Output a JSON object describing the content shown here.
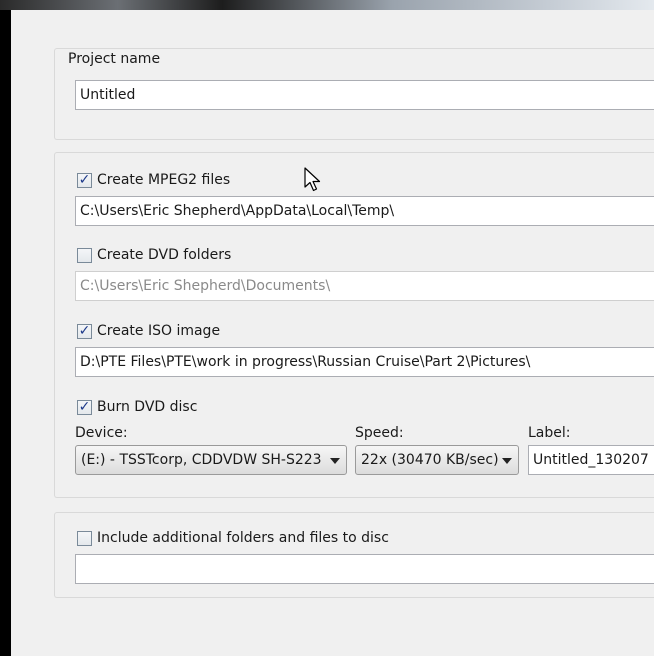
{
  "project": {
    "label": "Project name",
    "value": "Untitled"
  },
  "mpeg2": {
    "label": "Create MPEG2 files",
    "checked": true,
    "path": "C:\\Users\\Eric Shepherd\\AppData\\Local\\Temp\\"
  },
  "dvd_folders": {
    "label": "Create DVD folders",
    "checked": false,
    "path": "C:\\Users\\Eric Shepherd\\Documents\\"
  },
  "iso": {
    "label": "Create ISO image",
    "checked": true,
    "path": "D:\\PTE Files\\PTE\\work in progress\\Russian Cruise\\Part 2\\Pictures\\"
  },
  "burn": {
    "label": "Burn DVD disc",
    "checked": true,
    "device_label": "Device:",
    "device_value": "(E:) - TSSTcorp, CDDVDW SH-S223",
    "speed_label": "Speed:",
    "speed_value": "22x (30470 KB/sec)",
    "disc_label_label": "Label:",
    "disc_label_value": "Untitled_130207"
  },
  "additional": {
    "label": "Include additional folders and files to disc",
    "checked": false,
    "path": ""
  },
  "icons": {
    "checkmark": "checkmark-icon",
    "dropdown": "chevron-down-icon",
    "cursor": "mouse-pointer-icon"
  },
  "colors": {
    "panel_bg": "#f0f0f0",
    "field_border": "#abadb3",
    "check_mark": "#1e3a8a"
  }
}
